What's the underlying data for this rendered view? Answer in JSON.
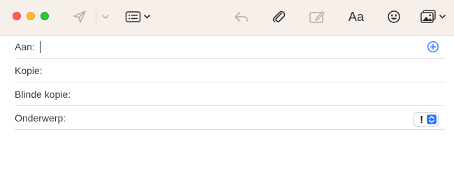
{
  "window": {
    "traffic_lights": [
      "close",
      "minimize",
      "zoom"
    ],
    "colors": {
      "close": "#fe5f57",
      "minimize": "#febc2e",
      "zoom": "#28c840"
    }
  },
  "toolbar": {
    "format_label": "Aa",
    "icons": [
      "send-icon",
      "chevron-down-icon",
      "header-fields-icon",
      "reply-icon",
      "attachment-icon",
      "markup-icon",
      "emoji-icon",
      "photo-browser-icon"
    ]
  },
  "fields": {
    "to_label": "Aan:",
    "cc_label": "Kopie:",
    "bcc_label": "Blinde kopie:",
    "subject_label": "Onderwerp:",
    "priority_mark": "!"
  },
  "colors": {
    "toolbar_bg": "#f6efea",
    "accent": "#3478f6"
  }
}
